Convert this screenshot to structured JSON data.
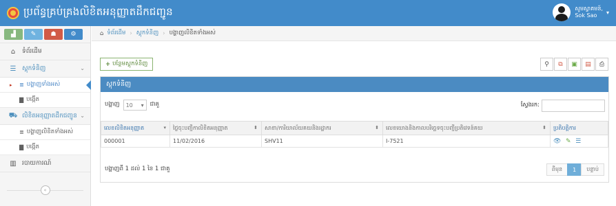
{
  "header": {
    "title": "ប្រព័ន្ធគ្រប់គ្រងលិខិតអនុញ្ញាតដឹកជញ្ជូន",
    "user_label": "សូមស្វាគមន៍,",
    "user_name": "Sok Sao",
    "caret": "▾"
  },
  "sidebar": {
    "shortcuts": [
      {
        "icon": "chart-icon",
        "color": "#87b87f",
        "glyph": "▟"
      },
      {
        "icon": "pencil-icon",
        "color": "#6fb3e0",
        "glyph": "✎"
      },
      {
        "icon": "users-icon",
        "color": "#d15b47",
        "glyph": "☗"
      },
      {
        "icon": "cogs-icon",
        "color": "#428bca",
        "glyph": "⚙"
      }
    ],
    "items": [
      {
        "label": "ទំព័រដើម",
        "icon": "home-icon",
        "glyph": "⌂"
      },
      {
        "label": "ស្តុកទំនិញ",
        "icon": "database-icon",
        "glyph": "☰",
        "chevron": "⌄"
      },
      {
        "label": "បង្ហាញទាំងអស់",
        "icon": "list-icon",
        "glyph": "≣",
        "sub": true,
        "active": true
      },
      {
        "label": "បង្កើត",
        "icon": "file-icon",
        "glyph": "▇",
        "sub": true
      },
      {
        "label": "លិខិតអនុញ្ញាតដឹកជញ្ជូន",
        "icon": "truck-icon",
        "glyph": "⛟",
        "chevron": "⌄"
      },
      {
        "label": "បង្ហាញលិខិតទាំងអស់",
        "icon": "list-icon",
        "glyph": "≣",
        "sub": true
      },
      {
        "label": "បង្កើត",
        "icon": "file-icon",
        "glyph": "▇",
        "sub": true
      },
      {
        "label": "របាយការណ៍",
        "icon": "bar-chart-icon",
        "glyph": "▥"
      }
    ],
    "collapse_glyph": "«"
  },
  "breadcrumb": {
    "home": "ទំព័រដើម",
    "section": "ស្តុកទំនិញ",
    "current": "បង្ហាញលិខិតទាំងអស់",
    "sep": "›"
  },
  "toolbar": {
    "add_label": "បន្ថែមស្តុកទំនិញ",
    "tools": [
      {
        "icon": "search-icon",
        "glyph": "⚲",
        "color": "#555"
      },
      {
        "icon": "copy-icon",
        "glyph": "⧉",
        "color": "#d15b47"
      },
      {
        "icon": "excel-icon",
        "glyph": "▣",
        "color": "#69aa46"
      },
      {
        "icon": "pdf-icon",
        "glyph": "▤",
        "color": "#d15b47"
      },
      {
        "icon": "print-icon",
        "glyph": "⎙",
        "color": "#333"
      }
    ]
  },
  "panel": {
    "title": "ស្តុកទំនិញ",
    "show_label": "បង្ហាញ",
    "page_size": "10",
    "rows_label": "ជាគួ",
    "search_label": "ស្វែងរក:",
    "columns": [
      "លេខលិខិតអនុញ្ញាត",
      "ថ្ងៃចុះបញ្ជីកាលិខិតអនុញ្ញាត",
      "សាខា/ការិយាល័យគយនិងរដ្ឋាករ",
      "លេខយោងនិងកាលបរិច្ឆេទចុះបញ្ជីប្រតិវេទន៍គយ",
      "ប្រតិបត្តិការ"
    ],
    "rows": [
      [
        "000001",
        "11/02/2016",
        "SHV11",
        "I-7521"
      ]
    ],
    "info": "បង្ហាញពី 1 ដល់ 1 នៃ 1 ជាគួ",
    "prev": "ពីមុន",
    "page": "1",
    "next": "បន្ទាប់"
  }
}
